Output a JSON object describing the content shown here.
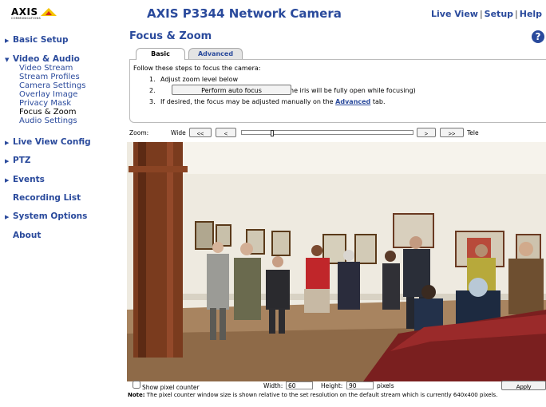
{
  "header": {
    "logo_text": "AXIS",
    "logo_sub": "COMMUNICATIONS",
    "product_title": "AXIS P3344 Network Camera",
    "links": [
      "Live View",
      "Setup",
      "Help"
    ]
  },
  "sidebar": {
    "items": [
      {
        "label": "Basic Setup",
        "arrow": "▶"
      },
      {
        "label": "Video & Audio",
        "arrow": "▼"
      },
      {
        "label": "Live View Config",
        "arrow": "▶"
      },
      {
        "label": "PTZ",
        "arrow": "▶"
      },
      {
        "label": "Events",
        "arrow": "▶"
      },
      {
        "label": "Recording List",
        "arrow": ""
      },
      {
        "label": "System Options",
        "arrow": "▶"
      },
      {
        "label": "About",
        "arrow": ""
      }
    ],
    "video_audio_sub": [
      "Video Stream",
      "Stream Profiles",
      "Camera Settings",
      "Overlay Image",
      "Privacy Mask",
      "Focus & Zoom",
      "Audio Settings"
    ]
  },
  "main": {
    "title": "Focus & Zoom",
    "help_icon": "?",
    "tabs": [
      "Basic",
      "Advanced"
    ],
    "intro": "Follow these steps to focus the camera:",
    "step1_num": "1.",
    "step1": "Adjust zoom level below",
    "step2_num": "2.",
    "autofocus_label": "Perform auto focus",
    "step2_after": "(The iris will be fully open while focusing)",
    "step3_num": "3.",
    "step3_before": "If desired, the focus may be adjusted manually on the",
    "step3_link": "Advanced",
    "step3_after": "tab."
  },
  "zoom": {
    "label": "Zoom:",
    "wide": "Wide",
    "tele": "Tele",
    "btn_far_left": "<<",
    "btn_left": "<",
    "btn_right": ">",
    "btn_far_right": ">>",
    "level": 0.17
  },
  "pixel_counter": {
    "show_label": "Show pixel counter",
    "width_label": "Width:",
    "width_value": "60",
    "height_label": "Height:",
    "height_value": "90",
    "unit": "pixels",
    "apply_label": "Apply",
    "note_bold": "Note:",
    "note_text": "The pixel counter window size is shown relative to the set resolution on the default stream which is currently 640x400 pixels."
  },
  "colors": {
    "accent": "#2a4a9c",
    "logo_yellow": "#f5c400",
    "logo_red": "#d52b1e"
  }
}
